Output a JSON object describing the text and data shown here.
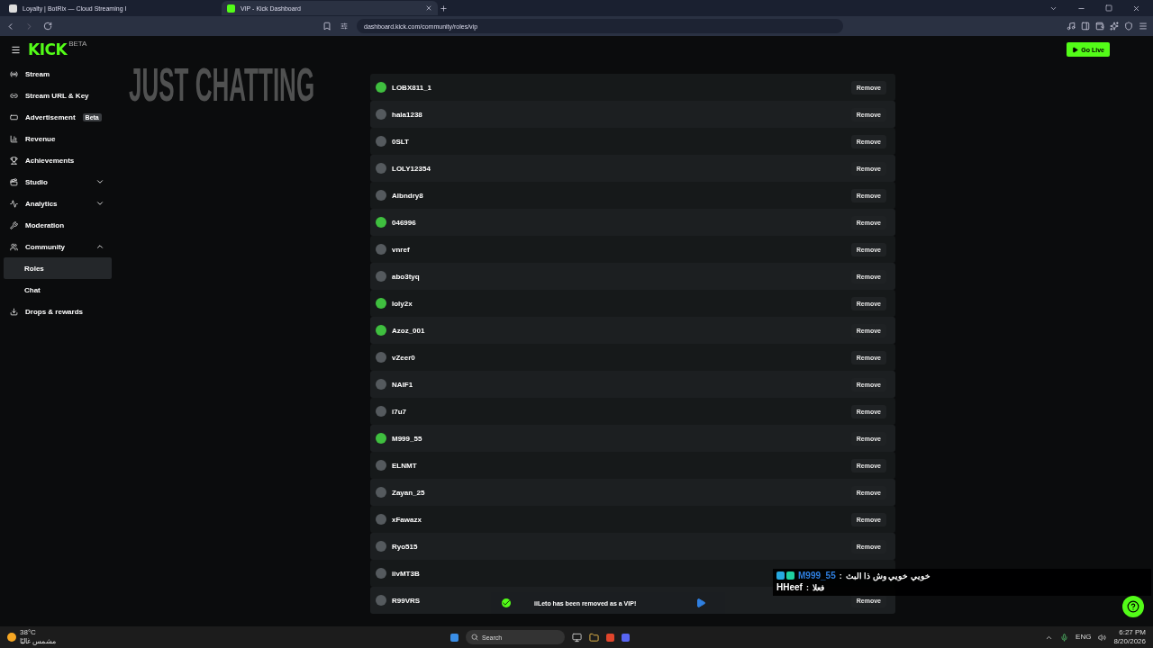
{
  "browser": {
    "tabs": [
      {
        "title": "Loyalty | BotRix — Cloud Streaming I",
        "selected": false
      },
      {
        "title": "VIP - Kick Dashboard",
        "selected": true
      }
    ],
    "url": "dashboard.kick.com/community/roles/vip"
  },
  "header": {
    "logo": "KICK",
    "logo_tag": "BETA",
    "go_live": "Go Live"
  },
  "sidebar": {
    "items": [
      {
        "label": "Stream",
        "selected": false
      },
      {
        "label": "Stream URL & Key",
        "selected": false
      },
      {
        "label": "Advertisement",
        "badge": "Beta",
        "selected": false
      },
      {
        "label": "Revenue",
        "selected": false
      },
      {
        "label": "Achievements",
        "selected": false
      },
      {
        "label": "Studio",
        "expanded": false,
        "selected": false
      },
      {
        "label": "Analytics",
        "expanded": false,
        "selected": false
      },
      {
        "label": "Moderation",
        "selected": false
      },
      {
        "label": "Community",
        "expanded": true,
        "selected": false,
        "children": [
          {
            "label": "Roles",
            "selected": true
          },
          {
            "label": "Chat",
            "selected": false
          }
        ]
      },
      {
        "label": "Drops & rewards",
        "selected": false
      }
    ]
  },
  "overlay_title": "JUST CHATTING",
  "vips": {
    "rows": [
      {
        "name": "LOBX811_1",
        "kind": "default",
        "button": "Remove"
      },
      {
        "name": "hala1238",
        "kind": "photo",
        "button": "Remove"
      },
      {
        "name": "0SLT",
        "kind": "photo",
        "button": "Remove"
      },
      {
        "name": "LOLY12354",
        "kind": "photo",
        "button": "Remove"
      },
      {
        "name": "Albndry8",
        "kind": "photo",
        "button": "Remove"
      },
      {
        "name": "046996",
        "kind": "default",
        "button": "Remove"
      },
      {
        "name": "vnref",
        "kind": "photo",
        "button": "Remove"
      },
      {
        "name": "abo3tyq",
        "kind": "photo",
        "button": "Remove"
      },
      {
        "name": "loly2x",
        "kind": "default",
        "button": "Remove"
      },
      {
        "name": "Azoz_001",
        "kind": "default",
        "button": "Remove"
      },
      {
        "name": "vZeer0",
        "kind": "photo",
        "button": "Remove"
      },
      {
        "name": "NAIF1",
        "kind": "photo",
        "button": "Remove"
      },
      {
        "name": "i7u7",
        "kind": "photo",
        "button": "Remove"
      },
      {
        "name": "M999_55",
        "kind": "default",
        "button": "Remove"
      },
      {
        "name": "ELNMT",
        "kind": "photo",
        "button": "Remove"
      },
      {
        "name": "Zayan_25",
        "kind": "photo",
        "button": "Remove"
      },
      {
        "name": "xFawazx",
        "kind": "photo",
        "button": "Remove"
      },
      {
        "name": "Ryo515",
        "kind": "photo",
        "button": "Remove"
      },
      {
        "name": "iivMT3B",
        "kind": "photo"
      },
      {
        "name": "R99VRS",
        "kind": "photo",
        "button": "Remove"
      }
    ]
  },
  "toast": {
    "message": "iiLeto has been removed as a VIP!"
  },
  "chat_overlay": [
    {
      "user": "M999_55",
      "separator": ":",
      "message": "خويي خويي وش ذا البث",
      "badges": true
    },
    {
      "user": "HHeef",
      "separator": ":",
      "message": "فعلا",
      "badges": false
    }
  ],
  "taskbar": {
    "temperature": "38°C",
    "weather": "مشمس غالبًا",
    "search": "Search",
    "language": "ENG",
    "time": "6:27 PM",
    "date": "8/20/2026"
  }
}
